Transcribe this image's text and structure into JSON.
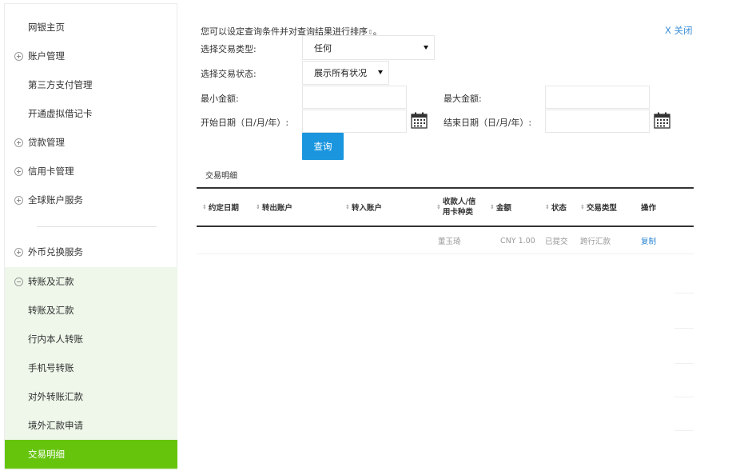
{
  "sidebar": {
    "items": [
      {
        "label": "网银主页",
        "type": "plain"
      },
      {
        "label": "账户管理",
        "type": "expandable"
      },
      {
        "label": "第三方支付管理",
        "type": "plain"
      },
      {
        "label": "开通虚拟借记卡",
        "type": "plain"
      },
      {
        "label": "贷款管理",
        "type": "expandable"
      },
      {
        "label": "信用卡管理",
        "type": "expandable"
      },
      {
        "label": "全球账户服务",
        "type": "expandable"
      },
      {
        "label": "外币兑换服务",
        "type": "expandable"
      },
      {
        "label": "转账及汇款",
        "type": "expanded"
      }
    ],
    "sub_items": [
      {
        "label": "转账及汇款"
      },
      {
        "label": "行内本人转账"
      },
      {
        "label": "手机号转账"
      },
      {
        "label": "对外转账汇款"
      },
      {
        "label": "境外汇款申请"
      },
      {
        "label": "交易明细",
        "active": true
      }
    ],
    "active_color": "#66c40d"
  },
  "filter": {
    "intro": "您可以设定查询条件并对查询结果进行排序",
    "close_label": "X 关闭",
    "type_label": "选择交易类型:",
    "type_value": "任何",
    "status_label": "选择交易状态:",
    "status_value": "展示所有状况",
    "min_label": "最小金额:",
    "max_label": "最大金额:",
    "start_label": "开始日期（日/月/年）:",
    "end_label": "结束日期（日/月/年）:",
    "query_label": "查询",
    "accent_color": "#1a95de"
  },
  "table": {
    "title": "交易明细",
    "columns": [
      "约定日期",
      "转出账户",
      "转入账户",
      "收款人/信用卡种类",
      "金额",
      "状态",
      "交易类型",
      "操作"
    ],
    "rows": [
      {
        "date": "",
        "from": "",
        "to": "",
        "payee": "董玉琦",
        "amount": "CNY 1.00",
        "status": "已提交",
        "type": "跨行汇款",
        "action": "复制"
      }
    ]
  }
}
